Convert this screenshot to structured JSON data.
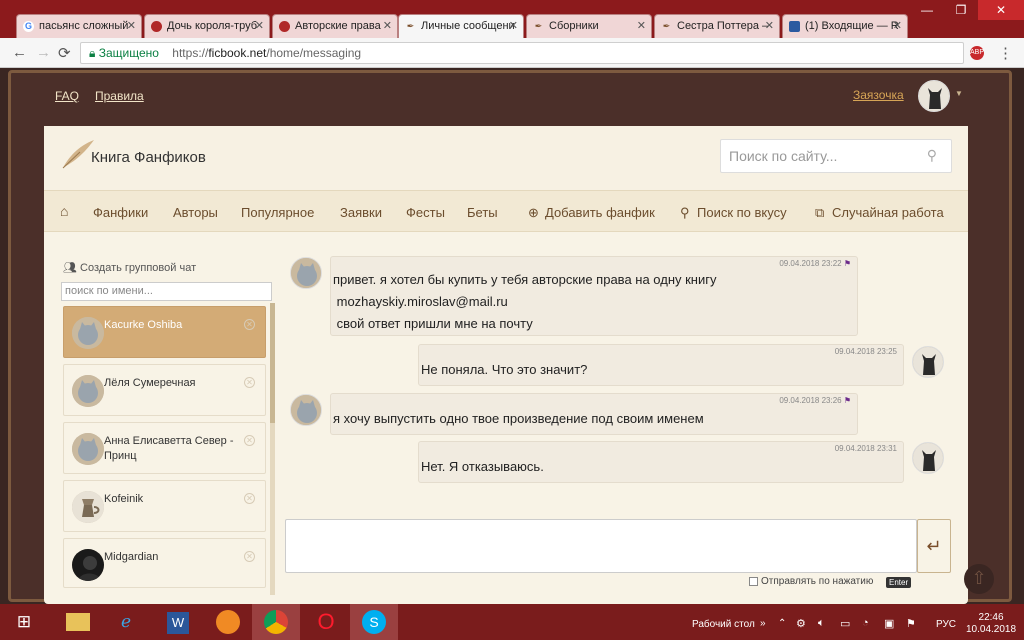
{
  "browser": {
    "tabs": [
      {
        "label": "пасьянс сложный",
        "icon": "google-icon",
        "color": "#4285f4"
      },
      {
        "label": "Дочь короля-труб",
        "icon": "chrome-tab-icon",
        "color": "#b02828"
      },
      {
        "label": "Авторские права",
        "icon": "chrome-tab-icon",
        "color": "#b02828"
      },
      {
        "label": "Личные сообщени",
        "icon": "feather-icon",
        "color": "#7a4e2a"
      },
      {
        "label": "Сборники",
        "icon": "feather-icon",
        "color": "#7a4e2a"
      },
      {
        "label": "Сестра Поттера –",
        "icon": "feather-icon",
        "color": "#7a4e2a"
      },
      {
        "label": "(1) Входящие — R",
        "icon": "mail-icon",
        "color": "#2c5aa0"
      }
    ],
    "secure_label": "Защищено",
    "url_prefix": "https://",
    "url_host": "ficbook.net",
    "url_path": "/home/messaging"
  },
  "site": {
    "top_links": [
      "FAQ",
      "Правила"
    ],
    "user_name": "Заязочка",
    "logo_text": "Книга Фанфиков",
    "search_placeholder": "Поиск по сайту...",
    "nav": [
      "Фанфики",
      "Авторы",
      "Популярное",
      "Заявки",
      "Фесты",
      "Беты",
      "Добавить фанфик",
      "Поиск по вкусу",
      "Случайная работа"
    ]
  },
  "sidebar": {
    "create_group": "Создать групповой чат",
    "search_placeholder": "поиск по имени...",
    "dialogs": [
      {
        "name": "Kacurke Oshiba",
        "active": true
      },
      {
        "name": "Лёля Сумеречная",
        "active": false
      },
      {
        "name": "Анна Елисаветта Север - Принц",
        "active": false
      },
      {
        "name": "Kofeinik",
        "active": false
      },
      {
        "name": "Midgardian",
        "active": false
      }
    ]
  },
  "messages": [
    {
      "time": "09.04.2018 23:22",
      "lines": [
        "привет. я хотел бы купить у тебя авторские права на одну книгу",
        " mozhayskiy.miroslav@mail.ru",
        " свой ответ пришли мне на почту"
      ],
      "own": false
    },
    {
      "time": "09.04.2018 23:25",
      "lines": [
        "Не поняла. Что это значит?"
      ],
      "own": true
    },
    {
      "time": "09.04.2018 23:26",
      "lines": [
        "я хочу выпустить одно твое произведение под своим именем"
      ],
      "own": false
    },
    {
      "time": "09.04.2018 23:31",
      "lines": [
        "Нет. Я отказываюсь."
      ],
      "own": true
    }
  ],
  "composer": {
    "send_option": "Отправлять по нажатию",
    "enter_key": "Enter"
  },
  "taskbar": {
    "desktop_label": "Рабочий стол",
    "lang": "РУС",
    "time": "22:46",
    "date": "10.04.2018"
  }
}
